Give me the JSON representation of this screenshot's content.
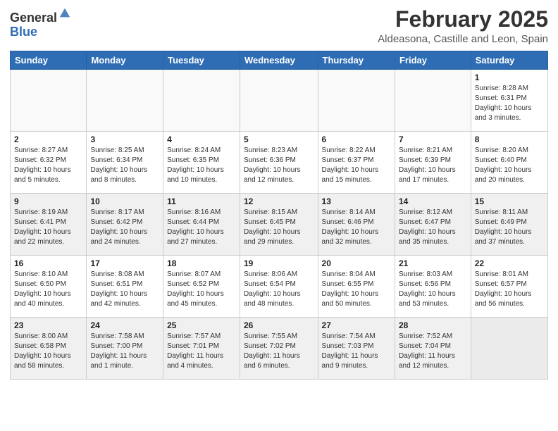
{
  "header": {
    "logo_general": "General",
    "logo_blue": "Blue",
    "month": "February 2025",
    "location": "Aldeasona, Castille and Leon, Spain"
  },
  "weekdays": [
    "Sunday",
    "Monday",
    "Tuesday",
    "Wednesday",
    "Thursday",
    "Friday",
    "Saturday"
  ],
  "weeks": [
    {
      "shaded": false,
      "days": [
        {
          "num": "",
          "info": ""
        },
        {
          "num": "",
          "info": ""
        },
        {
          "num": "",
          "info": ""
        },
        {
          "num": "",
          "info": ""
        },
        {
          "num": "",
          "info": ""
        },
        {
          "num": "",
          "info": ""
        },
        {
          "num": "1",
          "info": "Sunrise: 8:28 AM\nSunset: 6:31 PM\nDaylight: 10 hours\nand 3 minutes."
        }
      ]
    },
    {
      "shaded": false,
      "days": [
        {
          "num": "2",
          "info": "Sunrise: 8:27 AM\nSunset: 6:32 PM\nDaylight: 10 hours\nand 5 minutes."
        },
        {
          "num": "3",
          "info": "Sunrise: 8:25 AM\nSunset: 6:34 PM\nDaylight: 10 hours\nand 8 minutes."
        },
        {
          "num": "4",
          "info": "Sunrise: 8:24 AM\nSunset: 6:35 PM\nDaylight: 10 hours\nand 10 minutes."
        },
        {
          "num": "5",
          "info": "Sunrise: 8:23 AM\nSunset: 6:36 PM\nDaylight: 10 hours\nand 12 minutes."
        },
        {
          "num": "6",
          "info": "Sunrise: 8:22 AM\nSunset: 6:37 PM\nDaylight: 10 hours\nand 15 minutes."
        },
        {
          "num": "7",
          "info": "Sunrise: 8:21 AM\nSunset: 6:39 PM\nDaylight: 10 hours\nand 17 minutes."
        },
        {
          "num": "8",
          "info": "Sunrise: 8:20 AM\nSunset: 6:40 PM\nDaylight: 10 hours\nand 20 minutes."
        }
      ]
    },
    {
      "shaded": true,
      "days": [
        {
          "num": "9",
          "info": "Sunrise: 8:19 AM\nSunset: 6:41 PM\nDaylight: 10 hours\nand 22 minutes."
        },
        {
          "num": "10",
          "info": "Sunrise: 8:17 AM\nSunset: 6:42 PM\nDaylight: 10 hours\nand 24 minutes."
        },
        {
          "num": "11",
          "info": "Sunrise: 8:16 AM\nSunset: 6:44 PM\nDaylight: 10 hours\nand 27 minutes."
        },
        {
          "num": "12",
          "info": "Sunrise: 8:15 AM\nSunset: 6:45 PM\nDaylight: 10 hours\nand 29 minutes."
        },
        {
          "num": "13",
          "info": "Sunrise: 8:14 AM\nSunset: 6:46 PM\nDaylight: 10 hours\nand 32 minutes."
        },
        {
          "num": "14",
          "info": "Sunrise: 8:12 AM\nSunset: 6:47 PM\nDaylight: 10 hours\nand 35 minutes."
        },
        {
          "num": "15",
          "info": "Sunrise: 8:11 AM\nSunset: 6:49 PM\nDaylight: 10 hours\nand 37 minutes."
        }
      ]
    },
    {
      "shaded": false,
      "days": [
        {
          "num": "16",
          "info": "Sunrise: 8:10 AM\nSunset: 6:50 PM\nDaylight: 10 hours\nand 40 minutes."
        },
        {
          "num": "17",
          "info": "Sunrise: 8:08 AM\nSunset: 6:51 PM\nDaylight: 10 hours\nand 42 minutes."
        },
        {
          "num": "18",
          "info": "Sunrise: 8:07 AM\nSunset: 6:52 PM\nDaylight: 10 hours\nand 45 minutes."
        },
        {
          "num": "19",
          "info": "Sunrise: 8:06 AM\nSunset: 6:54 PM\nDaylight: 10 hours\nand 48 minutes."
        },
        {
          "num": "20",
          "info": "Sunrise: 8:04 AM\nSunset: 6:55 PM\nDaylight: 10 hours\nand 50 minutes."
        },
        {
          "num": "21",
          "info": "Sunrise: 8:03 AM\nSunset: 6:56 PM\nDaylight: 10 hours\nand 53 minutes."
        },
        {
          "num": "22",
          "info": "Sunrise: 8:01 AM\nSunset: 6:57 PM\nDaylight: 10 hours\nand 56 minutes."
        }
      ]
    },
    {
      "shaded": true,
      "days": [
        {
          "num": "23",
          "info": "Sunrise: 8:00 AM\nSunset: 6:58 PM\nDaylight: 10 hours\nand 58 minutes."
        },
        {
          "num": "24",
          "info": "Sunrise: 7:58 AM\nSunset: 7:00 PM\nDaylight: 11 hours\nand 1 minute."
        },
        {
          "num": "25",
          "info": "Sunrise: 7:57 AM\nSunset: 7:01 PM\nDaylight: 11 hours\nand 4 minutes."
        },
        {
          "num": "26",
          "info": "Sunrise: 7:55 AM\nSunset: 7:02 PM\nDaylight: 11 hours\nand 6 minutes."
        },
        {
          "num": "27",
          "info": "Sunrise: 7:54 AM\nSunset: 7:03 PM\nDaylight: 11 hours\nand 9 minutes."
        },
        {
          "num": "28",
          "info": "Sunrise: 7:52 AM\nSunset: 7:04 PM\nDaylight: 11 hours\nand 12 minutes."
        },
        {
          "num": "",
          "info": ""
        }
      ]
    }
  ]
}
